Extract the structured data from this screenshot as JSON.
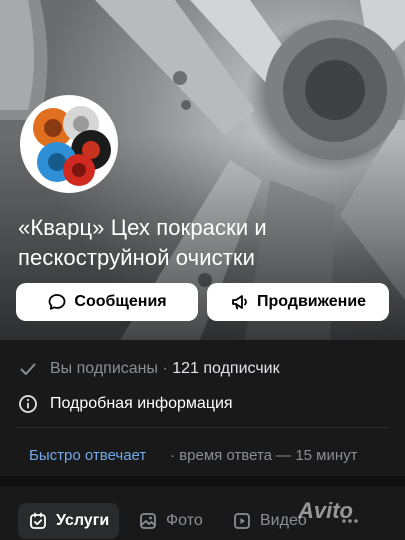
{
  "group": {
    "name": "«Кварц» Цех покраски и пескоструйной очистки"
  },
  "actions": {
    "messages_label": "Сообщения",
    "promotion_label": "Продвижение"
  },
  "subscription": {
    "status": "Вы подписаны",
    "separator": " · ",
    "subscribers": "121 подписчик"
  },
  "details": {
    "label": "Подробная информация"
  },
  "reply": {
    "fast": "Быстро отвечает",
    "separator": " · ",
    "time": "время ответа — 15 минут"
  },
  "tabs": [
    {
      "label": "Услуги",
      "icon": "calendar-check-icon",
      "active": true
    },
    {
      "label": "Фото",
      "icon": "image-icon",
      "active": false
    },
    {
      "label": "Видео",
      "icon": "video-icon",
      "active": false
    },
    {
      "label": "",
      "icon": "more-icon",
      "active": false
    }
  ],
  "watermark": "Avito",
  "colors": {
    "background": "#19191a",
    "link": "#71aaeb",
    "muted": "#8b8e93",
    "button_bg": "#ffffff"
  }
}
